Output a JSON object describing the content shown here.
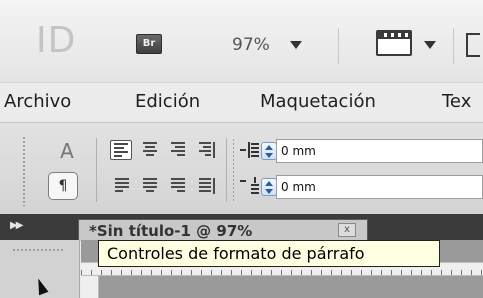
{
  "app_bar": {
    "logo_text": "ID",
    "bridge_label": "Br",
    "zoom_value": "97%"
  },
  "menu": {
    "items": [
      "Archivo",
      "Edición",
      "Maquetación",
      "Tex"
    ]
  },
  "control_panel": {
    "mode_character_label": "A",
    "mode_paragraph_label": "¶",
    "left_indent_value": "0 mm",
    "first_line_indent_value": "0 mm"
  },
  "document_tab": {
    "title": "*Sin título-1 @ 97%",
    "close_label": "x"
  },
  "tooltip": {
    "text": "Controles de formato de párrafo"
  },
  "colors": {
    "tooltip_bg": "#ffffe1",
    "tab_bar_bg": "#3b3b3b",
    "stepper_accent": "#2b5d9c"
  },
  "icons": [
    "bridge-icon",
    "view-options-icon",
    "align-left-icon",
    "align-center-icon",
    "align-right-icon",
    "align-towards-spine-icon",
    "justify-left-icon",
    "justify-center-icon",
    "justify-right-icon",
    "justify-all-icon",
    "left-indent-icon",
    "first-line-indent-icon",
    "selection-tool-icon"
  ]
}
